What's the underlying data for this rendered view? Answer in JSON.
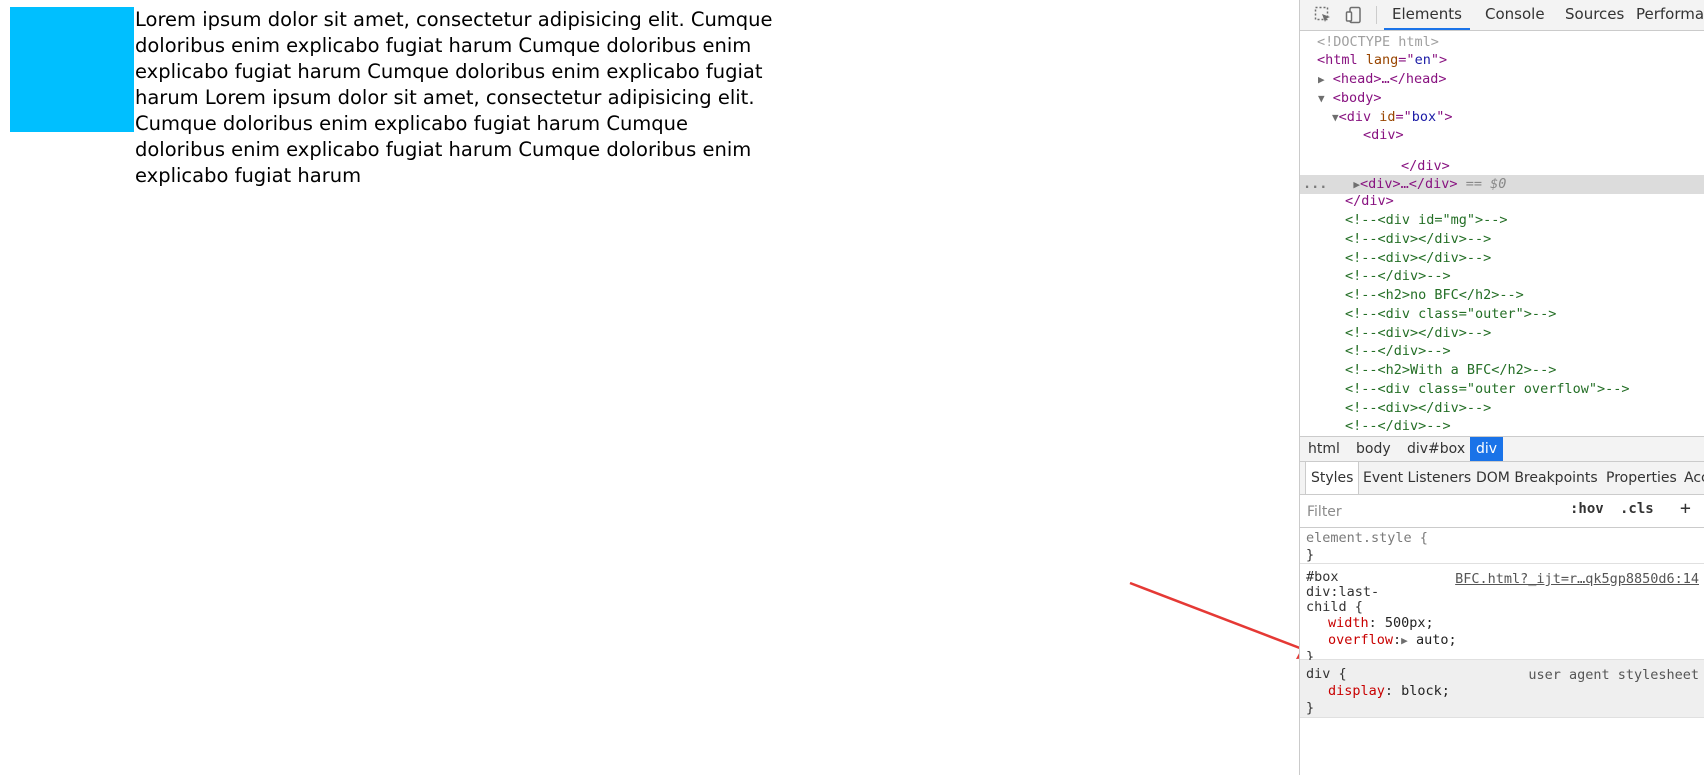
{
  "page": {
    "paragraph_lines": [
      "Lorem ipsum dolor sit amet, consectetur adipisicing elit. Cumque",
      "doloribus enim explicabo fugiat harum Cumque doloribus enim",
      "explicabo fugiat harum Cumque doloribus enim explicabo fugiat",
      "harum Lorem ipsum dolor sit amet, consectetur adipisicing elit.",
      "Cumque doloribus enim explicabo fugiat harum Cumque",
      "doloribus enim explicabo fugiat harum Cumque doloribus enim",
      "explicabo fugiat harum"
    ],
    "box_color": "#00bfff",
    "arrow_color": "#e53935"
  },
  "devtools": {
    "tabs": [
      "Elements",
      "Console",
      "Sources",
      "Performan"
    ],
    "active_tab": "Elements",
    "dom_lines": [
      {
        "text": "<!DOCTYPE html>"
      },
      {
        "parts": [
          "<html ",
          "lang",
          "=\"",
          "en",
          "\">"
        ]
      },
      {
        "text": "<head>…</head>"
      },
      {
        "text": "<body>"
      },
      {
        "parts": [
          "<div ",
          "id",
          "=\"",
          "box",
          "\">"
        ]
      },
      {
        "text": "<div>"
      },
      {
        "text": "</div>"
      },
      {
        "text": "<div>…</div>",
        "suffix": "== $0",
        "gutter": "..."
      },
      {
        "text": "</div>"
      },
      {
        "text": "<!--<div id=\"mg\">-->"
      },
      {
        "text": "<!--<div></div>-->"
      },
      {
        "text": "<!--<div></div>-->"
      },
      {
        "text": "<!--</div>-->"
      },
      {
        "text": "<!--<h2>no BFC</h2>-->"
      },
      {
        "text": "<!--<div class=\"outer\">-->"
      },
      {
        "text": "<!--<div></div>-->"
      },
      {
        "text": "<!--</div>-->"
      },
      {
        "text": "<!--<h2>With a BFC</h2>-->"
      },
      {
        "text": "<!--<div class=\"outer overflow\">-->"
      },
      {
        "text": "<!--<div></div>-->"
      },
      {
        "text": "<!--</div>-->"
      }
    ],
    "breadcrumbs": [
      "html",
      "body",
      "div#box",
      "div"
    ],
    "active_breadcrumb": "div",
    "subtabs": [
      "Styles",
      "Event Listeners",
      "DOM Breakpoints",
      "Properties",
      "Acc"
    ],
    "filter_placeholder": "Filter",
    "hov": ":hov",
    "cls": ".cls",
    "add": "+",
    "rules": {
      "element_style": {
        "selector": "element.style {",
        "close": "}"
      },
      "box_rule": {
        "selector_lines": [
          "#box",
          "div:last-",
          "child {"
        ],
        "link": "BFC.html?_ijt=r…qk5gp8850d6:14",
        "props": [
          {
            "name": "width",
            "value": "500px;"
          },
          {
            "name": "overflow",
            "value": "auto;",
            "expandable": true
          }
        ],
        "close": "}"
      },
      "ua_rule": {
        "selector": "div {",
        "label": "user agent stylesheet",
        "props": [
          {
            "name": "display",
            "value": "block;"
          }
        ],
        "close": "}"
      }
    }
  }
}
